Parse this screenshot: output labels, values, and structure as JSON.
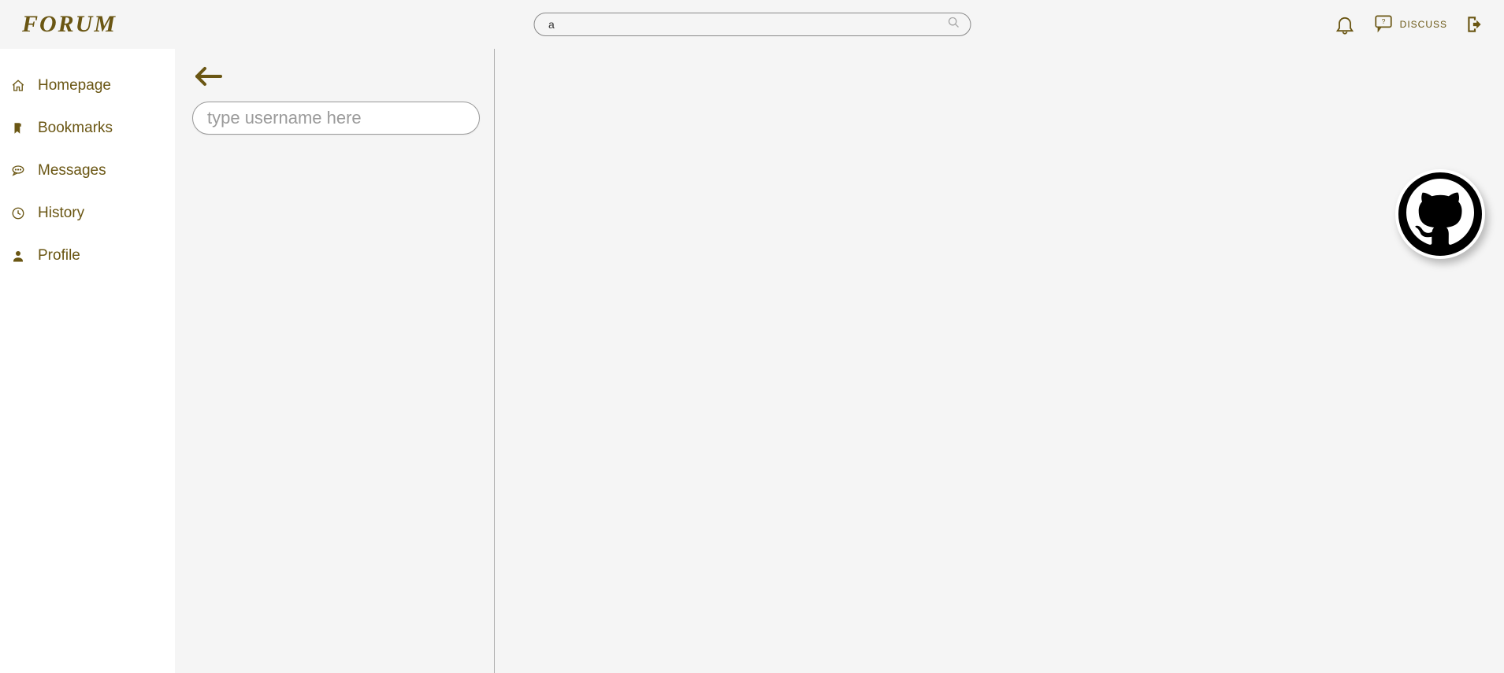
{
  "brand": {
    "logo_text": "FORUM"
  },
  "header": {
    "search_value": "a",
    "discuss_label": "DISCUSS"
  },
  "sidebar": {
    "items": [
      {
        "label": "Homepage"
      },
      {
        "label": "Bookmarks"
      },
      {
        "label": "Messages"
      },
      {
        "label": "History"
      },
      {
        "label": "Profile"
      }
    ]
  },
  "messages": {
    "username_placeholder": "type username here"
  },
  "colors": {
    "brand": "#6a5613",
    "page_bg": "#f5f5f5",
    "panel_bg": "#ffffff"
  }
}
